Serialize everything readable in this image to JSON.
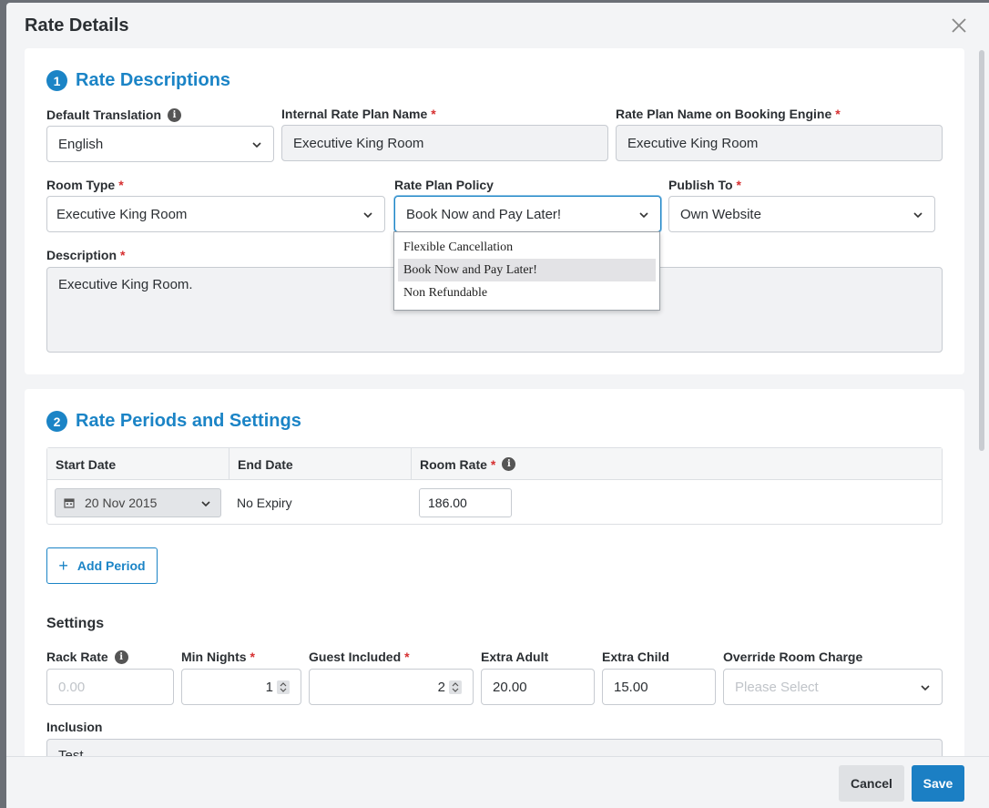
{
  "modal": {
    "title": "Rate Details"
  },
  "section1": {
    "step": "1",
    "title": "Rate Descriptions",
    "default_translation": {
      "label": "Default Translation",
      "value": "English"
    },
    "internal_name": {
      "label": "Internal Rate Plan Name",
      "value": "Executive King Room"
    },
    "engine_name": {
      "label": "Rate Plan Name on Booking Engine",
      "value": "Executive King Room"
    },
    "room_type": {
      "label": "Room Type",
      "value": "Executive King Room"
    },
    "policy": {
      "label": "Rate Plan Policy",
      "value": "Book Now and Pay Later!",
      "options": [
        "Flexible Cancellation",
        "Book Now and Pay Later!",
        "Non Refundable"
      ]
    },
    "publish_to": {
      "label": "Publish To",
      "value": "Own Website"
    },
    "description": {
      "label": "Description",
      "value": "Executive King Room."
    }
  },
  "section2": {
    "step": "2",
    "title": "Rate Periods and Settings",
    "table": {
      "headers": {
        "start": "Start Date",
        "end": "End Date",
        "rate": "Room Rate"
      },
      "row": {
        "start": "20 Nov 2015",
        "end": "No Expiry",
        "rate": "186.00"
      }
    },
    "add_period": "Add Period",
    "settings_title": "Settings",
    "rack_rate": {
      "label": "Rack Rate",
      "placeholder": "0.00"
    },
    "min_nights": {
      "label": "Min Nights",
      "value": "1"
    },
    "guest_included": {
      "label": "Guest Included",
      "value": "2"
    },
    "extra_adult": {
      "label": "Extra Adult",
      "value": "20.00"
    },
    "extra_child": {
      "label": "Extra Child",
      "value": "15.00"
    },
    "override_charge": {
      "label": "Override Room Charge",
      "placeholder": "Please Select"
    },
    "inclusion": {
      "label": "Inclusion",
      "value": "Test"
    }
  },
  "footer": {
    "cancel": "Cancel",
    "save": "Save"
  },
  "required_mark": "*",
  "info_mark": "i",
  "colors": {
    "accent": "#1b84c6",
    "required": "#d63031"
  }
}
